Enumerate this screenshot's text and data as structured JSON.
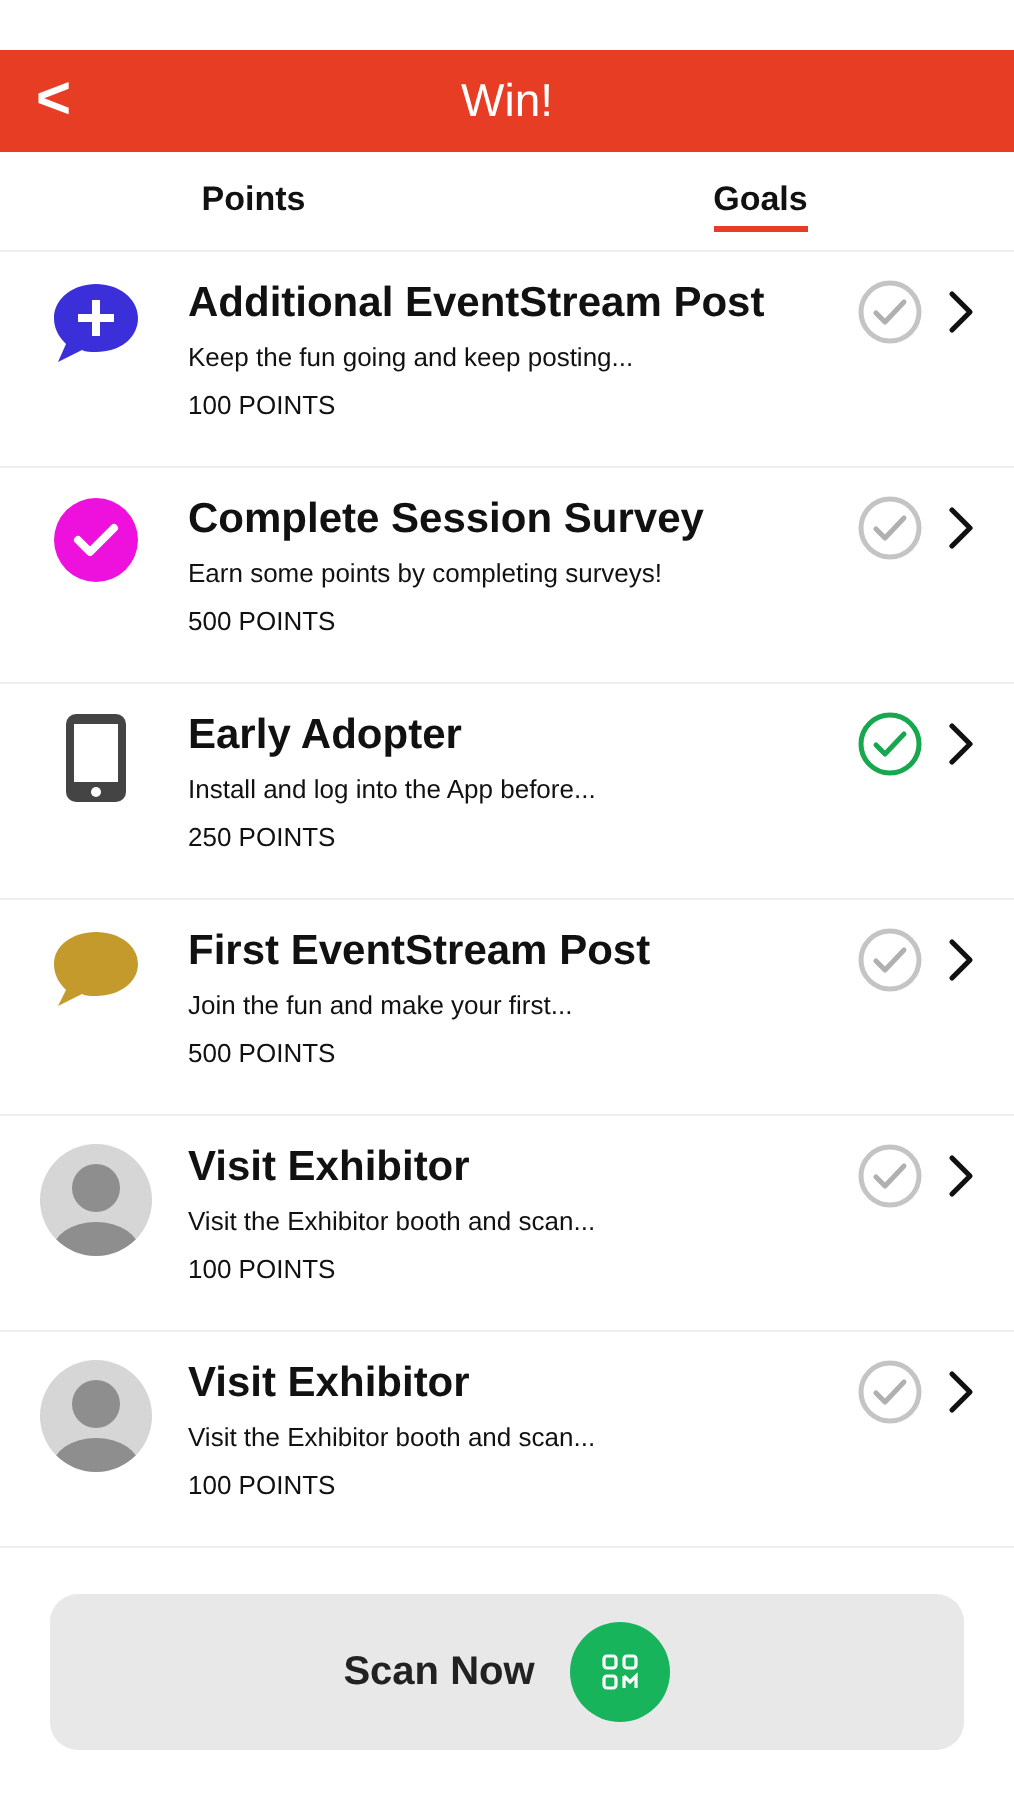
{
  "header": {
    "back": "<",
    "title": "Win!"
  },
  "tabs": [
    {
      "label": "Points",
      "selected": false
    },
    {
      "label": "Goals",
      "selected": true
    }
  ],
  "goals": [
    {
      "kind": "plus",
      "color": "#3b2fd9",
      "title": "Additional EventStream Post",
      "description": "Keep the fun going and keep posting...",
      "points": "100 POINTS",
      "completed": false
    },
    {
      "kind": "survey",
      "color": "#ee11dd",
      "title": "Complete Session Survey",
      "description": "Earn some points by completing surveys!",
      "points": "500 POINTS",
      "completed": false
    },
    {
      "kind": "device",
      "title": "Early Adopter",
      "description": "Install and log into the App before...",
      "points": "250 POINTS",
      "completed": true
    },
    {
      "kind": "post",
      "color": "#c49a2c",
      "title": "First EventStream Post",
      "description": "Join the fun and make your first...",
      "points": "500 POINTS",
      "completed": false
    },
    {
      "kind": "person",
      "title": "Visit Exhibitor",
      "description": "Visit the Exhibitor booth and scan...",
      "points": "100 POINTS",
      "completed": false
    },
    {
      "kind": "person",
      "title": "Visit Exhibitor",
      "description": "Visit the Exhibitor booth and scan...",
      "points": "100 POINTS",
      "completed": false
    }
  ],
  "scan_button": {
    "label": "Scan Now"
  }
}
